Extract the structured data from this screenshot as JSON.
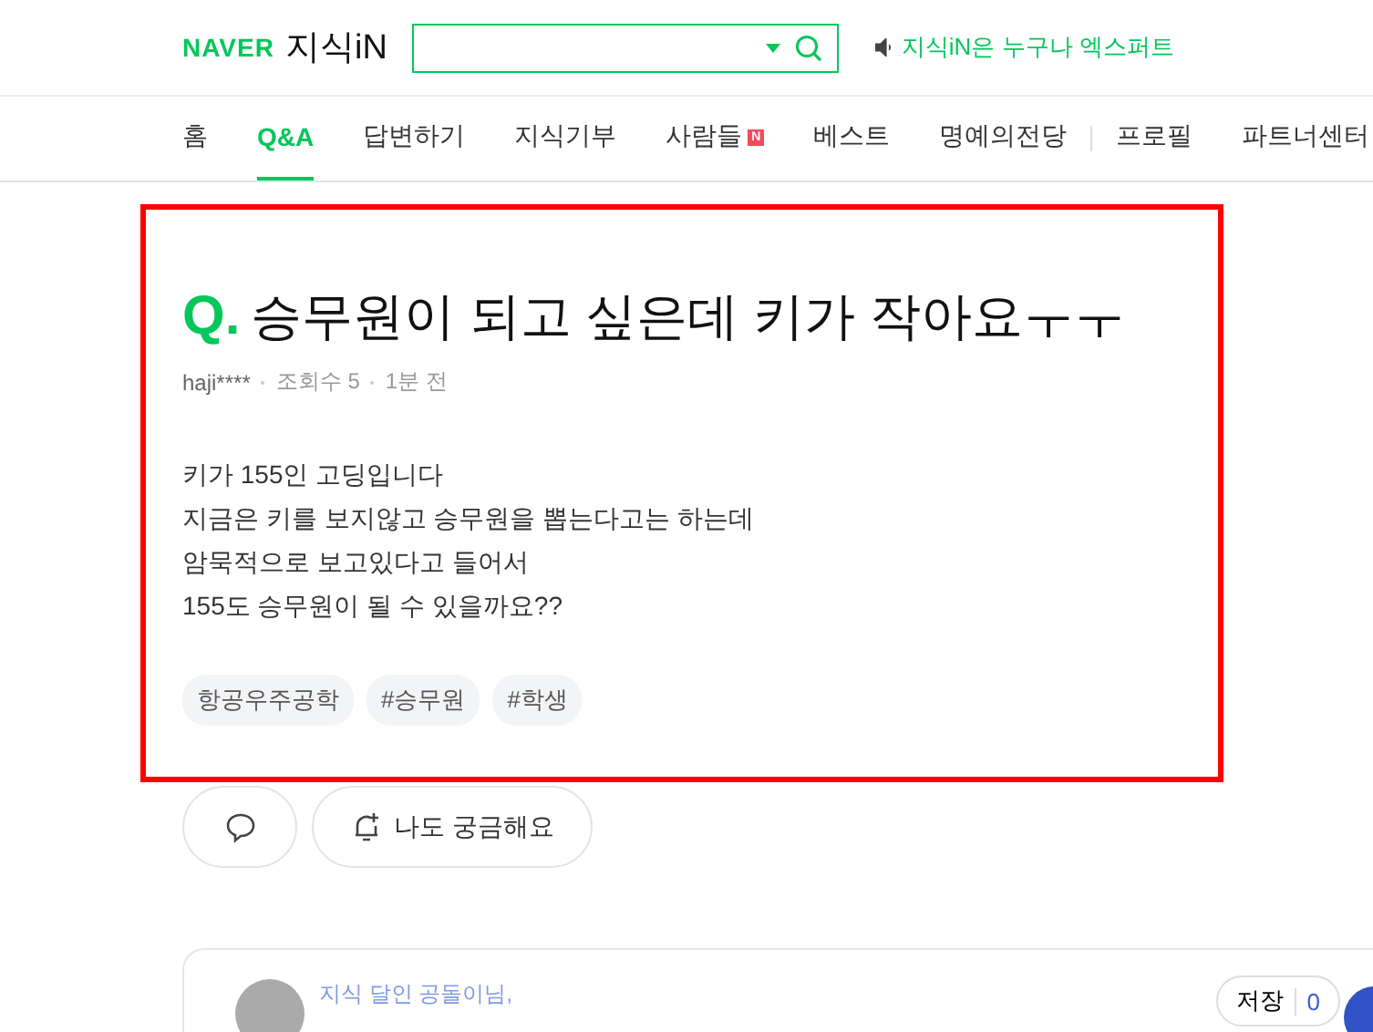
{
  "header": {
    "logo_brand": "NAVER",
    "logo_service": "지식iN",
    "notice": "지식iN은 누구나 엑스퍼트"
  },
  "nav": [
    {
      "label": "홈",
      "selected": false
    },
    {
      "label": "Q&A",
      "selected": true
    },
    {
      "label": "답변하기",
      "selected": false
    },
    {
      "label": "지식기부",
      "selected": false
    },
    {
      "label": "사람들",
      "selected": false,
      "badge": "N"
    },
    {
      "label": "베스트",
      "selected": false
    },
    {
      "label": "명예의전당",
      "selected": false
    },
    {
      "label": "프로필",
      "selected": false
    },
    {
      "label": "파트너센터",
      "selected": false
    }
  ],
  "question": {
    "marker": "Q.",
    "title": "승무원이 되고 싶은데 키가 작아요ㅜㅜ",
    "author": "haji****",
    "views": "조회수 5",
    "time": "1분 전",
    "body": [
      "키가 155인 고딩입니다",
      "지금은 키를 보지않고 승무원을 뽑는다고는 하는데",
      "암묵적으로 보고있다고 들어서",
      "155도 승무원이 될 수 있을까요??"
    ],
    "tags": [
      "항공우주공학",
      "#승무원",
      "#학생"
    ]
  },
  "actions": {
    "curious": "나도 궁금해요"
  },
  "answer": {
    "author": "지식 달인 공돌이님,",
    "save": "저장",
    "save_count": "0"
  }
}
